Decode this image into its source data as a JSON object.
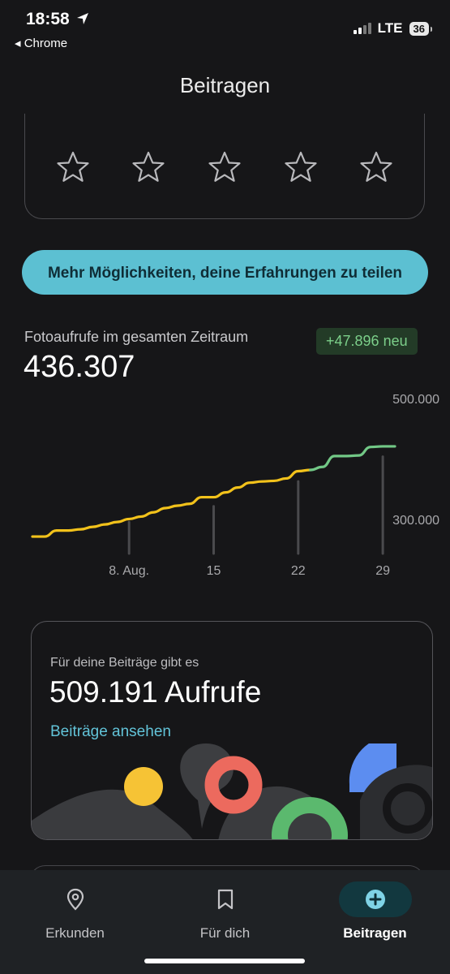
{
  "status": {
    "time": "18:58",
    "back_app": "◂ Chrome",
    "network": "LTE",
    "battery": "36"
  },
  "page": {
    "title": "Beitragen"
  },
  "rating": {
    "stars_total": 5,
    "stars_filled": 0
  },
  "share_button": {
    "label": "Mehr Möglichkeiten, deine Erfahrungen zu teilen"
  },
  "photo_views": {
    "label": "Fotoaufrufe im gesamten Zeitraum",
    "total": "436.307",
    "new_badge": "+47.896 neu"
  },
  "chart_data": {
    "type": "line",
    "x_ticks": [
      "8. Aug.",
      "15",
      "22",
      "29"
    ],
    "y_ticks": [
      "500.000",
      "300.000"
    ],
    "ylim": [
      260000,
      500000
    ],
    "series": [
      {
        "color": "#f2c21b",
        "values": [
          [
            0,
            272000
          ],
          [
            1,
            272000
          ],
          [
            2,
            282000
          ],
          [
            3,
            282000
          ],
          [
            4,
            284000
          ],
          [
            5,
            288000
          ],
          [
            6,
            292000
          ],
          [
            7,
            296000
          ],
          [
            8,
            301000
          ],
          [
            9,
            305000
          ],
          [
            10,
            312000
          ],
          [
            11,
            319000
          ],
          [
            12,
            323000
          ],
          [
            13,
            326000
          ],
          [
            14,
            337000
          ],
          [
            15,
            337000
          ],
          [
            16,
            345000
          ],
          [
            17,
            353000
          ],
          [
            18,
            361000
          ],
          [
            19,
            363000
          ],
          [
            20,
            364000
          ],
          [
            21,
            368000
          ],
          [
            22,
            380000
          ],
          [
            23,
            382000
          ]
        ]
      },
      {
        "color": "#72c886",
        "values": [
          [
            23,
            382000
          ],
          [
            24,
            387000
          ],
          [
            25,
            405000
          ],
          [
            26,
            405000
          ],
          [
            27,
            406000
          ],
          [
            28,
            420000
          ],
          [
            29,
            421000
          ],
          [
            30,
            421000
          ]
        ]
      }
    ],
    "weekly_bars": [
      {
        "x": 8,
        "v": 296000
      },
      {
        "x": 15,
        "v": 322000
      },
      {
        "x": 22,
        "v": 363000
      },
      {
        "x": 29,
        "v": 404000
      }
    ]
  },
  "contributions": {
    "subtitle": "Für deine Beiträge gibt es",
    "views": "509.191 Aufrufe",
    "link": "Beiträge ansehen"
  },
  "nav": {
    "items": [
      {
        "label": "Erkunden",
        "icon": "location-pin-icon"
      },
      {
        "label": "Für dich",
        "icon": "bookmark-icon"
      },
      {
        "label": "Beitragen",
        "icon": "add-circle-icon",
        "active": true
      }
    ]
  }
}
